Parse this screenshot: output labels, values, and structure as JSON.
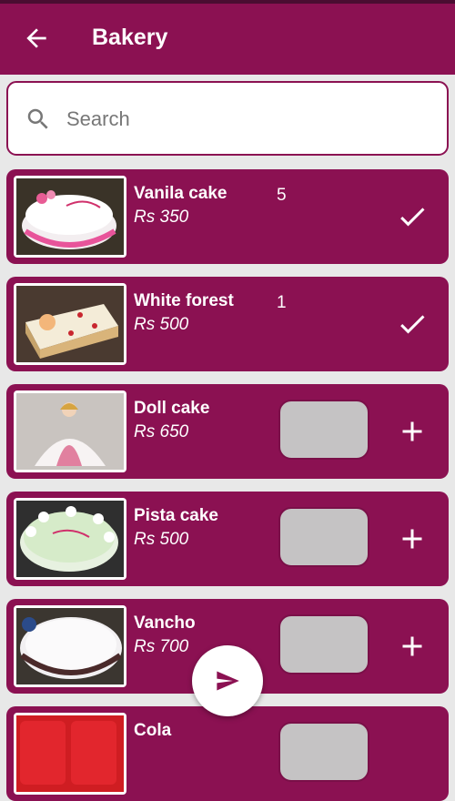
{
  "appbar": {
    "title": "Bakery"
  },
  "search": {
    "placeholder": "Search"
  },
  "items": [
    {
      "name": "Vanila cake",
      "price": "Rs 350",
      "qty": "5",
      "state": "added"
    },
    {
      "name": "White forest",
      "price": "Rs 500",
      "qty": "1",
      "state": "added"
    },
    {
      "name": "Doll cake",
      "price": "Rs 650",
      "qty": "",
      "state": "add"
    },
    {
      "name": "Pista cake",
      "price": "Rs 500",
      "qty": "",
      "state": "add"
    },
    {
      "name": "Vancho",
      "price": "Rs 700",
      "qty": "",
      "state": "add"
    },
    {
      "name": "Cola",
      "price": "",
      "qty": "",
      "state": "add"
    }
  ],
  "icons": {
    "back": "arrow-left-icon",
    "search": "search-icon",
    "added": "check-icon",
    "add": "plus-icon",
    "send": "send-icon"
  },
  "colors": {
    "primary": "#8b1152",
    "statusbar": "#4a0d31",
    "background": "#e8e8e8",
    "qty_box": "#c5c3c4"
  }
}
